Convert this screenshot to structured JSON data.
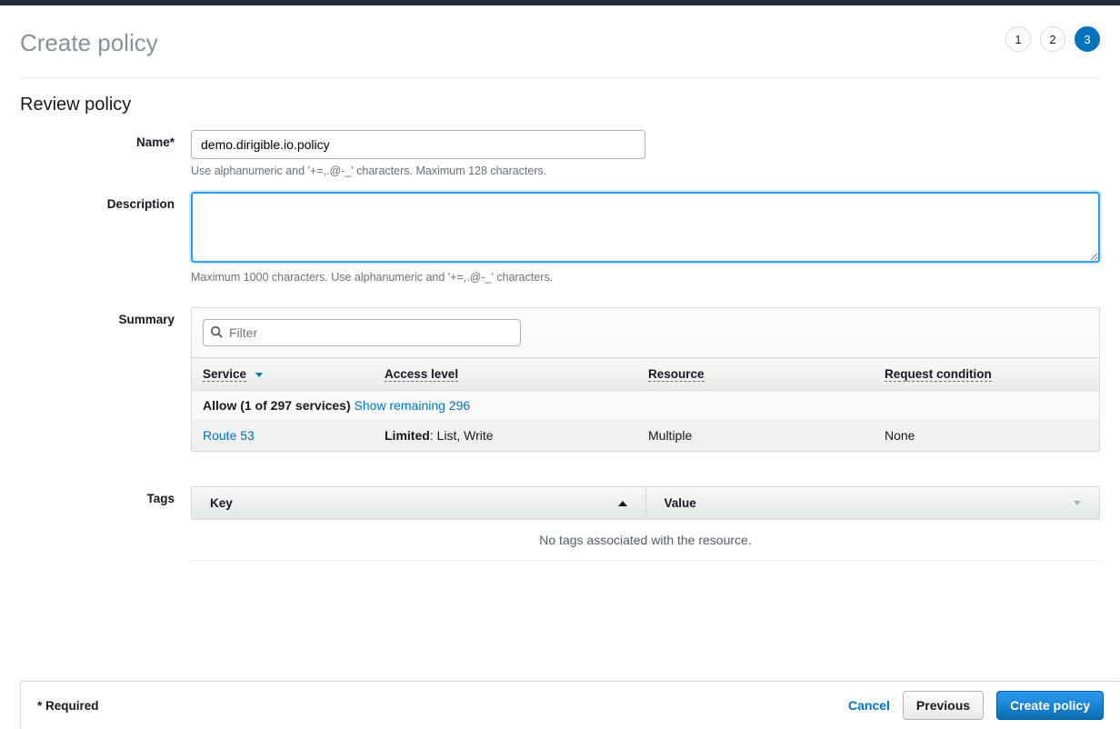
{
  "page": {
    "title": "Create policy",
    "section_title": "Review policy"
  },
  "steps": {
    "s1": "1",
    "s2": "2",
    "s3": "3"
  },
  "form": {
    "name_label": "Name*",
    "name_value": "demo.dirigible.io.policy",
    "name_hint": "Use alphanumeric and '+=,.@-_' characters. Maximum 128 characters.",
    "desc_label": "Description",
    "desc_value": "",
    "desc_hint": "Maximum 1000 characters. Use alphanumeric and '+=,.@-_' characters.",
    "summary_label": "Summary",
    "tags_label": "Tags"
  },
  "summary": {
    "filter_placeholder": "Filter",
    "cols": {
      "service": "Service",
      "access": "Access level",
      "resource": "Resource",
      "condition": "Request condition"
    },
    "allow_prefix": "Allow (1 of 297 services) ",
    "show_remaining": "Show remaining 296",
    "row": {
      "service": "Route 53",
      "access_bold": "Limited",
      "access_rest": ": List, Write",
      "resource": "Multiple",
      "condition": "None"
    }
  },
  "tags": {
    "key": "Key",
    "value": "Value",
    "empty": "No tags associated with the resource."
  },
  "footer": {
    "required": "* Required",
    "cancel": "Cancel",
    "previous": "Previous",
    "create": "Create policy"
  }
}
